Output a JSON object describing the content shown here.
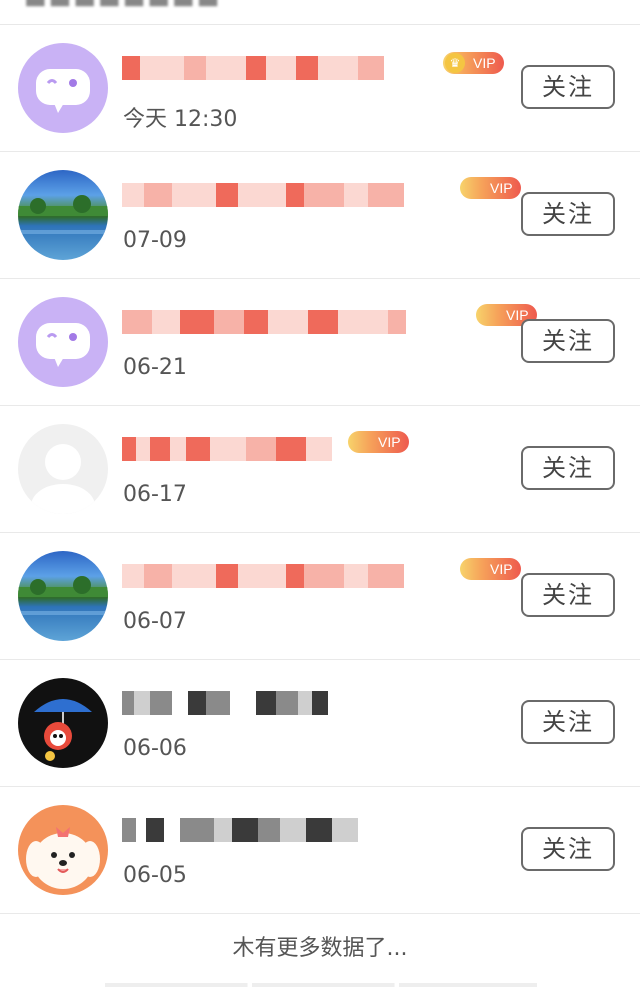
{
  "follow_list": {
    "items": [
      {
        "avatar_icon": "chat-bubble-face-icon",
        "vip_label": "VIP",
        "date": "今天 12:30",
        "follow_label": "关注"
      },
      {
        "avatar_icon": "lake-landscape-avatar",
        "vip_label": "VIP",
        "date": "07-09",
        "follow_label": "关注"
      },
      {
        "avatar_icon": "chat-bubble-face-icon",
        "vip_label": "VIP",
        "date": "06-21",
        "follow_label": "关注"
      },
      {
        "avatar_icon": "default-user-avatar",
        "vip_label": "VIP",
        "date": "06-17",
        "follow_label": "关注"
      },
      {
        "avatar_icon": "lake-landscape-avatar",
        "vip_label": "VIP",
        "date": "06-07",
        "follow_label": "关注"
      },
      {
        "avatar_icon": "cartoon-fox-umbrella-avatar",
        "vip_label": "",
        "date": "06-06",
        "follow_label": "关注"
      },
      {
        "avatar_icon": "cartoon-dog-avatar",
        "vip_label": "",
        "date": "06-05",
        "follow_label": "关注"
      }
    ]
  },
  "footer": {
    "no_more_text": "木有更多数据了..."
  },
  "colors": {
    "vip_gradient_start": "#f7d36b",
    "vip_gradient_end": "#ee5a4e",
    "avatar_purple": "#c9b2f5",
    "follow_border": "#6a6a6a"
  }
}
